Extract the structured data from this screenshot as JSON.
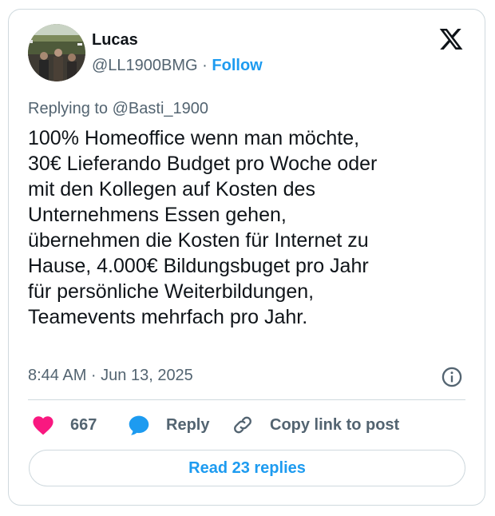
{
  "author": {
    "name": "Lucas",
    "handle": "@LL1900BMG",
    "separator": "·",
    "follow_label": "Follow"
  },
  "reply_context": {
    "prefix": "Replying to ",
    "mention": "@Basti_1900"
  },
  "post": {
    "lines": [
      "100% Homeoffice wenn man möchte,",
      "30€ Lieferando Budget pro Woche oder",
      "mit den Kollegen auf Kosten des",
      "Unternehmens Essen gehen,",
      "übernehmen die Kosten für Internet zu",
      "Hause, 4.000€ Bildungsbuget pro Jahr",
      "für persönliche Weiterbildungen,",
      "Teamevents mehrfach pro Jahr."
    ],
    "timestamp": "8:44 AM · Jun 13, 2025"
  },
  "actions": {
    "like_count": "667",
    "reply_label": "Reply",
    "copy_link_label": "Copy link to post"
  },
  "read_replies_label": "Read 23 replies",
  "icons": {
    "like": "heart-icon",
    "reply": "speech-bubble-icon",
    "copy_link": "link-icon",
    "info": "info-icon",
    "brand": "x-logo-icon"
  },
  "colors": {
    "accent": "#1d9bf0",
    "like": "#f91880",
    "text": "#0f1419",
    "muted": "#536471",
    "border": "#cfd9de"
  }
}
